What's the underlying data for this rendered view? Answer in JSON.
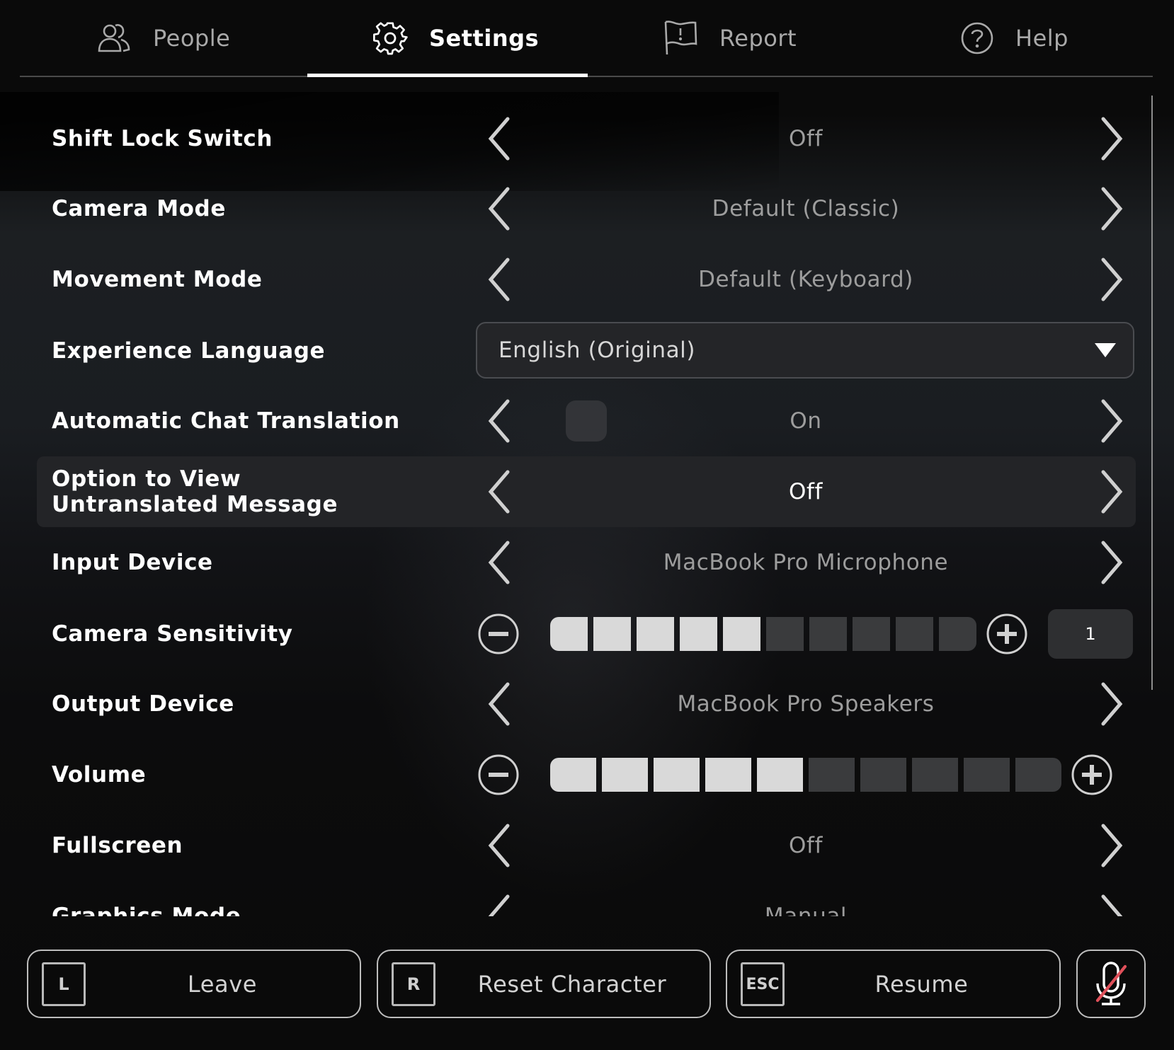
{
  "tabs": [
    {
      "label": "People",
      "icon": "people-icon",
      "active": false
    },
    {
      "label": "Settings",
      "icon": "gear-icon",
      "active": true
    },
    {
      "label": "Report",
      "icon": "flag-icon",
      "active": false
    },
    {
      "label": "Help",
      "icon": "help-icon",
      "active": false
    }
  ],
  "settings": {
    "shift_lock": {
      "label": "Shift Lock Switch",
      "value": "Off"
    },
    "camera_mode": {
      "label": "Camera Mode",
      "value": "Default (Classic)"
    },
    "movement_mode": {
      "label": "Movement Mode",
      "value": "Default (Keyboard)"
    },
    "experience_language": {
      "label": "Experience Language",
      "value": "English (Original)"
    },
    "auto_chat_translation": {
      "label": "Automatic Chat Translation",
      "value": "On"
    },
    "view_untranslated": {
      "label": "Option to View Untranslated Message",
      "value": "Off"
    },
    "input_device": {
      "label": "Input Device",
      "value": "MacBook Pro Microphone"
    },
    "camera_sensitivity": {
      "label": "Camera Sensitivity",
      "level": 5,
      "max_level": 10,
      "value": "1"
    },
    "output_device": {
      "label": "Output Device",
      "value": "MacBook Pro Speakers"
    },
    "volume": {
      "label": "Volume",
      "level": 5,
      "max_level": 10
    },
    "fullscreen": {
      "label": "Fullscreen",
      "value": "Off"
    },
    "graphics_mode": {
      "label": "Graphics Mode",
      "value": "Manual"
    }
  },
  "bottom_bar": {
    "leave": {
      "key": "L",
      "label": "Leave"
    },
    "reset": {
      "key": "R",
      "label": "Reset Character"
    },
    "resume": {
      "key": "ESC",
      "label": "Resume"
    },
    "mic": {
      "icon": "mic-muted-icon",
      "muted": true
    }
  },
  "colors": {
    "accent_active_tab": "#ffffff",
    "mute_slash": "#e0505a",
    "slider_on": "#d9d9d9",
    "slider_off": "#3a3b3d"
  }
}
